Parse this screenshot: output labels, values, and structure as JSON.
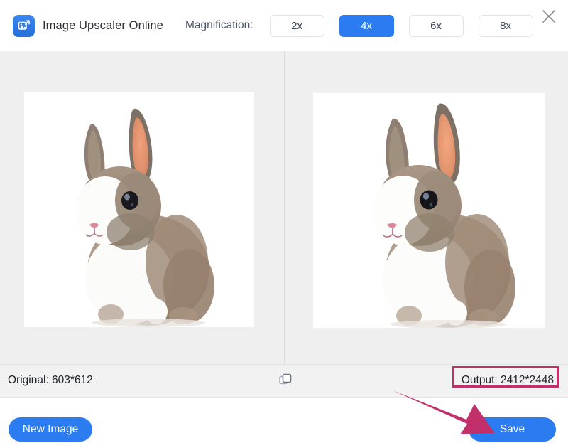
{
  "header": {
    "app_icon": "image-upscale-icon",
    "title": "Image Upscaler Online",
    "magnification_label": "Magnification:",
    "magnification_options": [
      {
        "label": "2x",
        "selected": false
      },
      {
        "label": "4x",
        "selected": true
      },
      {
        "label": "6x",
        "selected": false
      },
      {
        "label": "8x",
        "selected": false
      }
    ],
    "close_icon": "close-icon"
  },
  "preview": {
    "left_pane": {
      "alt": "original rabbit photo"
    },
    "right_pane": {
      "alt": "upscaled rabbit photo"
    }
  },
  "statusbar": {
    "original_label": "Original: 603*612",
    "copy_icon": "copy-icon",
    "output_label": "Output: 2412*2448"
  },
  "footer": {
    "new_image_label": "New Image",
    "save_label": "Save"
  },
  "colors": {
    "accent_blue": "#2b7cf0",
    "annotation_pink": "#c2306c",
    "panel_gray": "#efefef",
    "statusbar_gray": "#f2f2f2"
  },
  "annotations": {
    "arrow": "pointer-arrow-to-save",
    "highlight_box": "output-highlight-box"
  }
}
